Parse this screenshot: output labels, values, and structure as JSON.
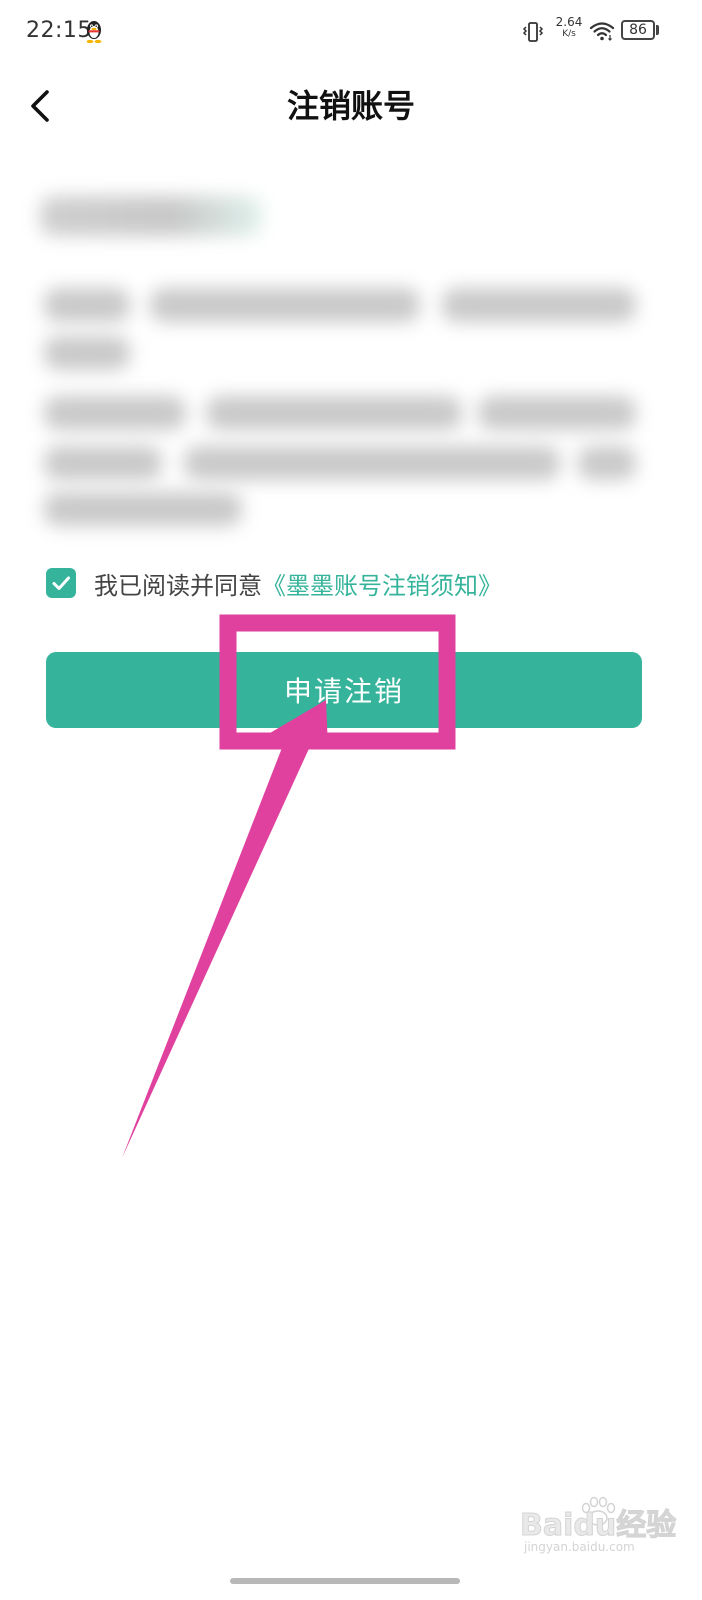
{
  "status_bar": {
    "time": "22:15",
    "net_speed_value": "2.64",
    "net_speed_unit": "K/s",
    "battery_level": "86",
    "icons": [
      "qq-icon",
      "vibrate-icon",
      "wifi-icon",
      "battery-icon"
    ]
  },
  "header": {
    "title": "注销账号",
    "back_icon": "chevron-left-icon"
  },
  "agreement": {
    "checked": true,
    "text": "我已阅读并同意",
    "link_text": "《墨墨账号注销须知》"
  },
  "apply_button": {
    "label": "申请注销"
  },
  "watermark": {
    "brand": "Baidu经验",
    "url": "jingyan.baidu.com"
  },
  "colors": {
    "accent": "#36b49b",
    "annotation": "#e0409e",
    "background": "#ffffff",
    "title_text": "#111111"
  }
}
